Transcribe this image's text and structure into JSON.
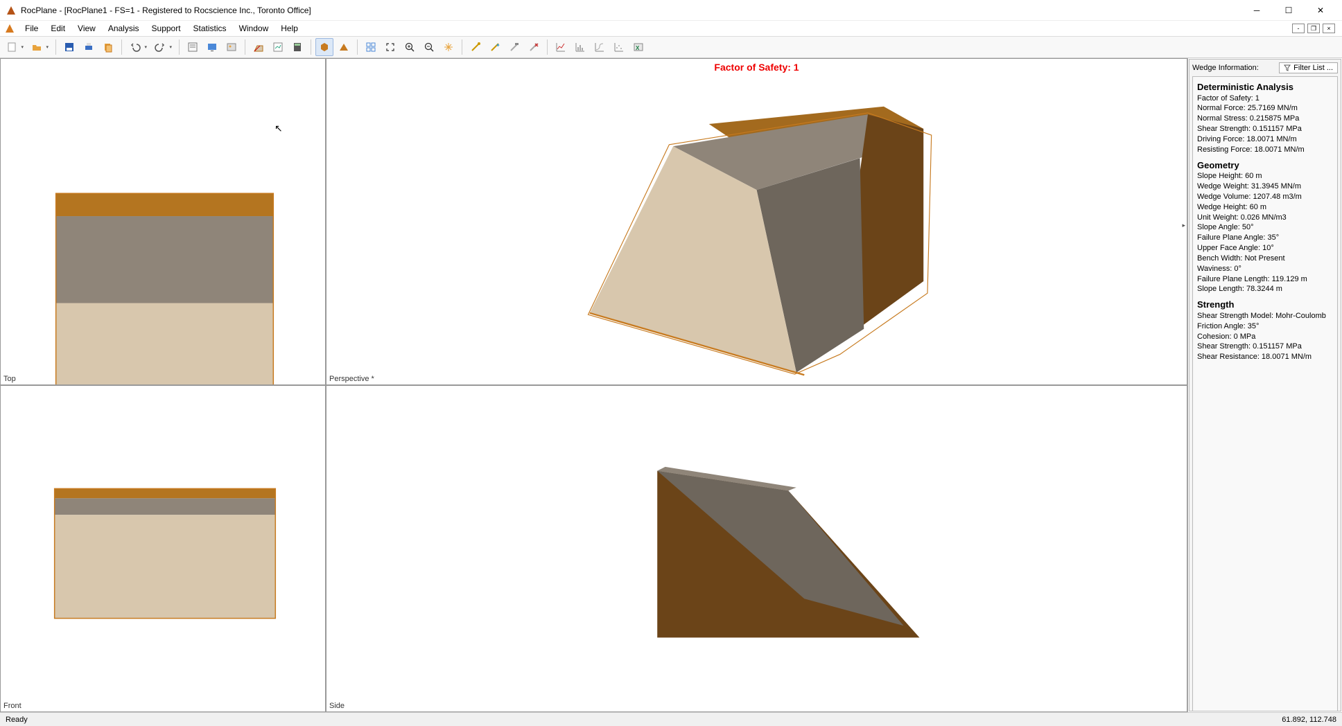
{
  "window": {
    "title": "RocPlane - [RocPlane1 - FS=1 - Registered to Rocscience Inc., Toronto Office]"
  },
  "menu": [
    "File",
    "Edit",
    "View",
    "Analysis",
    "Support",
    "Statistics",
    "Window",
    "Help"
  ],
  "viewport": {
    "fos_label": "Factor of Safety: 1",
    "labels": {
      "top": "Top",
      "front": "Front",
      "perspective": "Perspective *",
      "side": "Side"
    }
  },
  "sidepanel": {
    "header": "Wedge Information:",
    "filter_btn": "Filter List ...",
    "deterministic": {
      "title": "Deterministic Analysis",
      "rows": [
        "Factor of Safety: 1",
        "Normal Force: 25.7169 MN/m",
        "Normal Stress: 0.215875 MPa",
        "Shear Strength: 0.151157 MPa",
        "Driving Force: 18.0071 MN/m",
        "Resisting Force: 18.0071 MN/m"
      ]
    },
    "geometry": {
      "title": "Geometry",
      "rows": [
        "Slope Height: 60 m",
        "Wedge Weight: 31.3945 MN/m",
        "Wedge Volume: 1207.48 m3/m",
        "Wedge Height: 60 m",
        "Unit Weight: 0.026 MN/m3",
        "Slope Angle: 50°",
        "Failure Plane Angle: 35°",
        "Upper Face Angle: 10°",
        "Bench Width: Not Present",
        "Waviness: 0°",
        "Failure Plane Length: 119.129 m",
        "Slope Length: 78.3244 m"
      ]
    },
    "strength": {
      "title": "Strength",
      "rows": [
        "Shear Strength Model: Mohr-Coulomb",
        "Friction Angle: 35°",
        "Cohesion: 0 MPa",
        "Shear Strength: 0.151157 MPa",
        "Shear Resistance: 18.0071 MN/m"
      ]
    }
  },
  "statusbar": {
    "left": "Ready",
    "coords": "61.892, 112.748"
  },
  "colors": {
    "slope_dark": "#A36A1E",
    "slope_top": "#B47520",
    "rock_mid": "#8F8579",
    "rock_light": "#D8C7AD",
    "wedge_side": "#6E665C",
    "wedge_dark": "#6B4418",
    "outline": "#C77A1F"
  }
}
